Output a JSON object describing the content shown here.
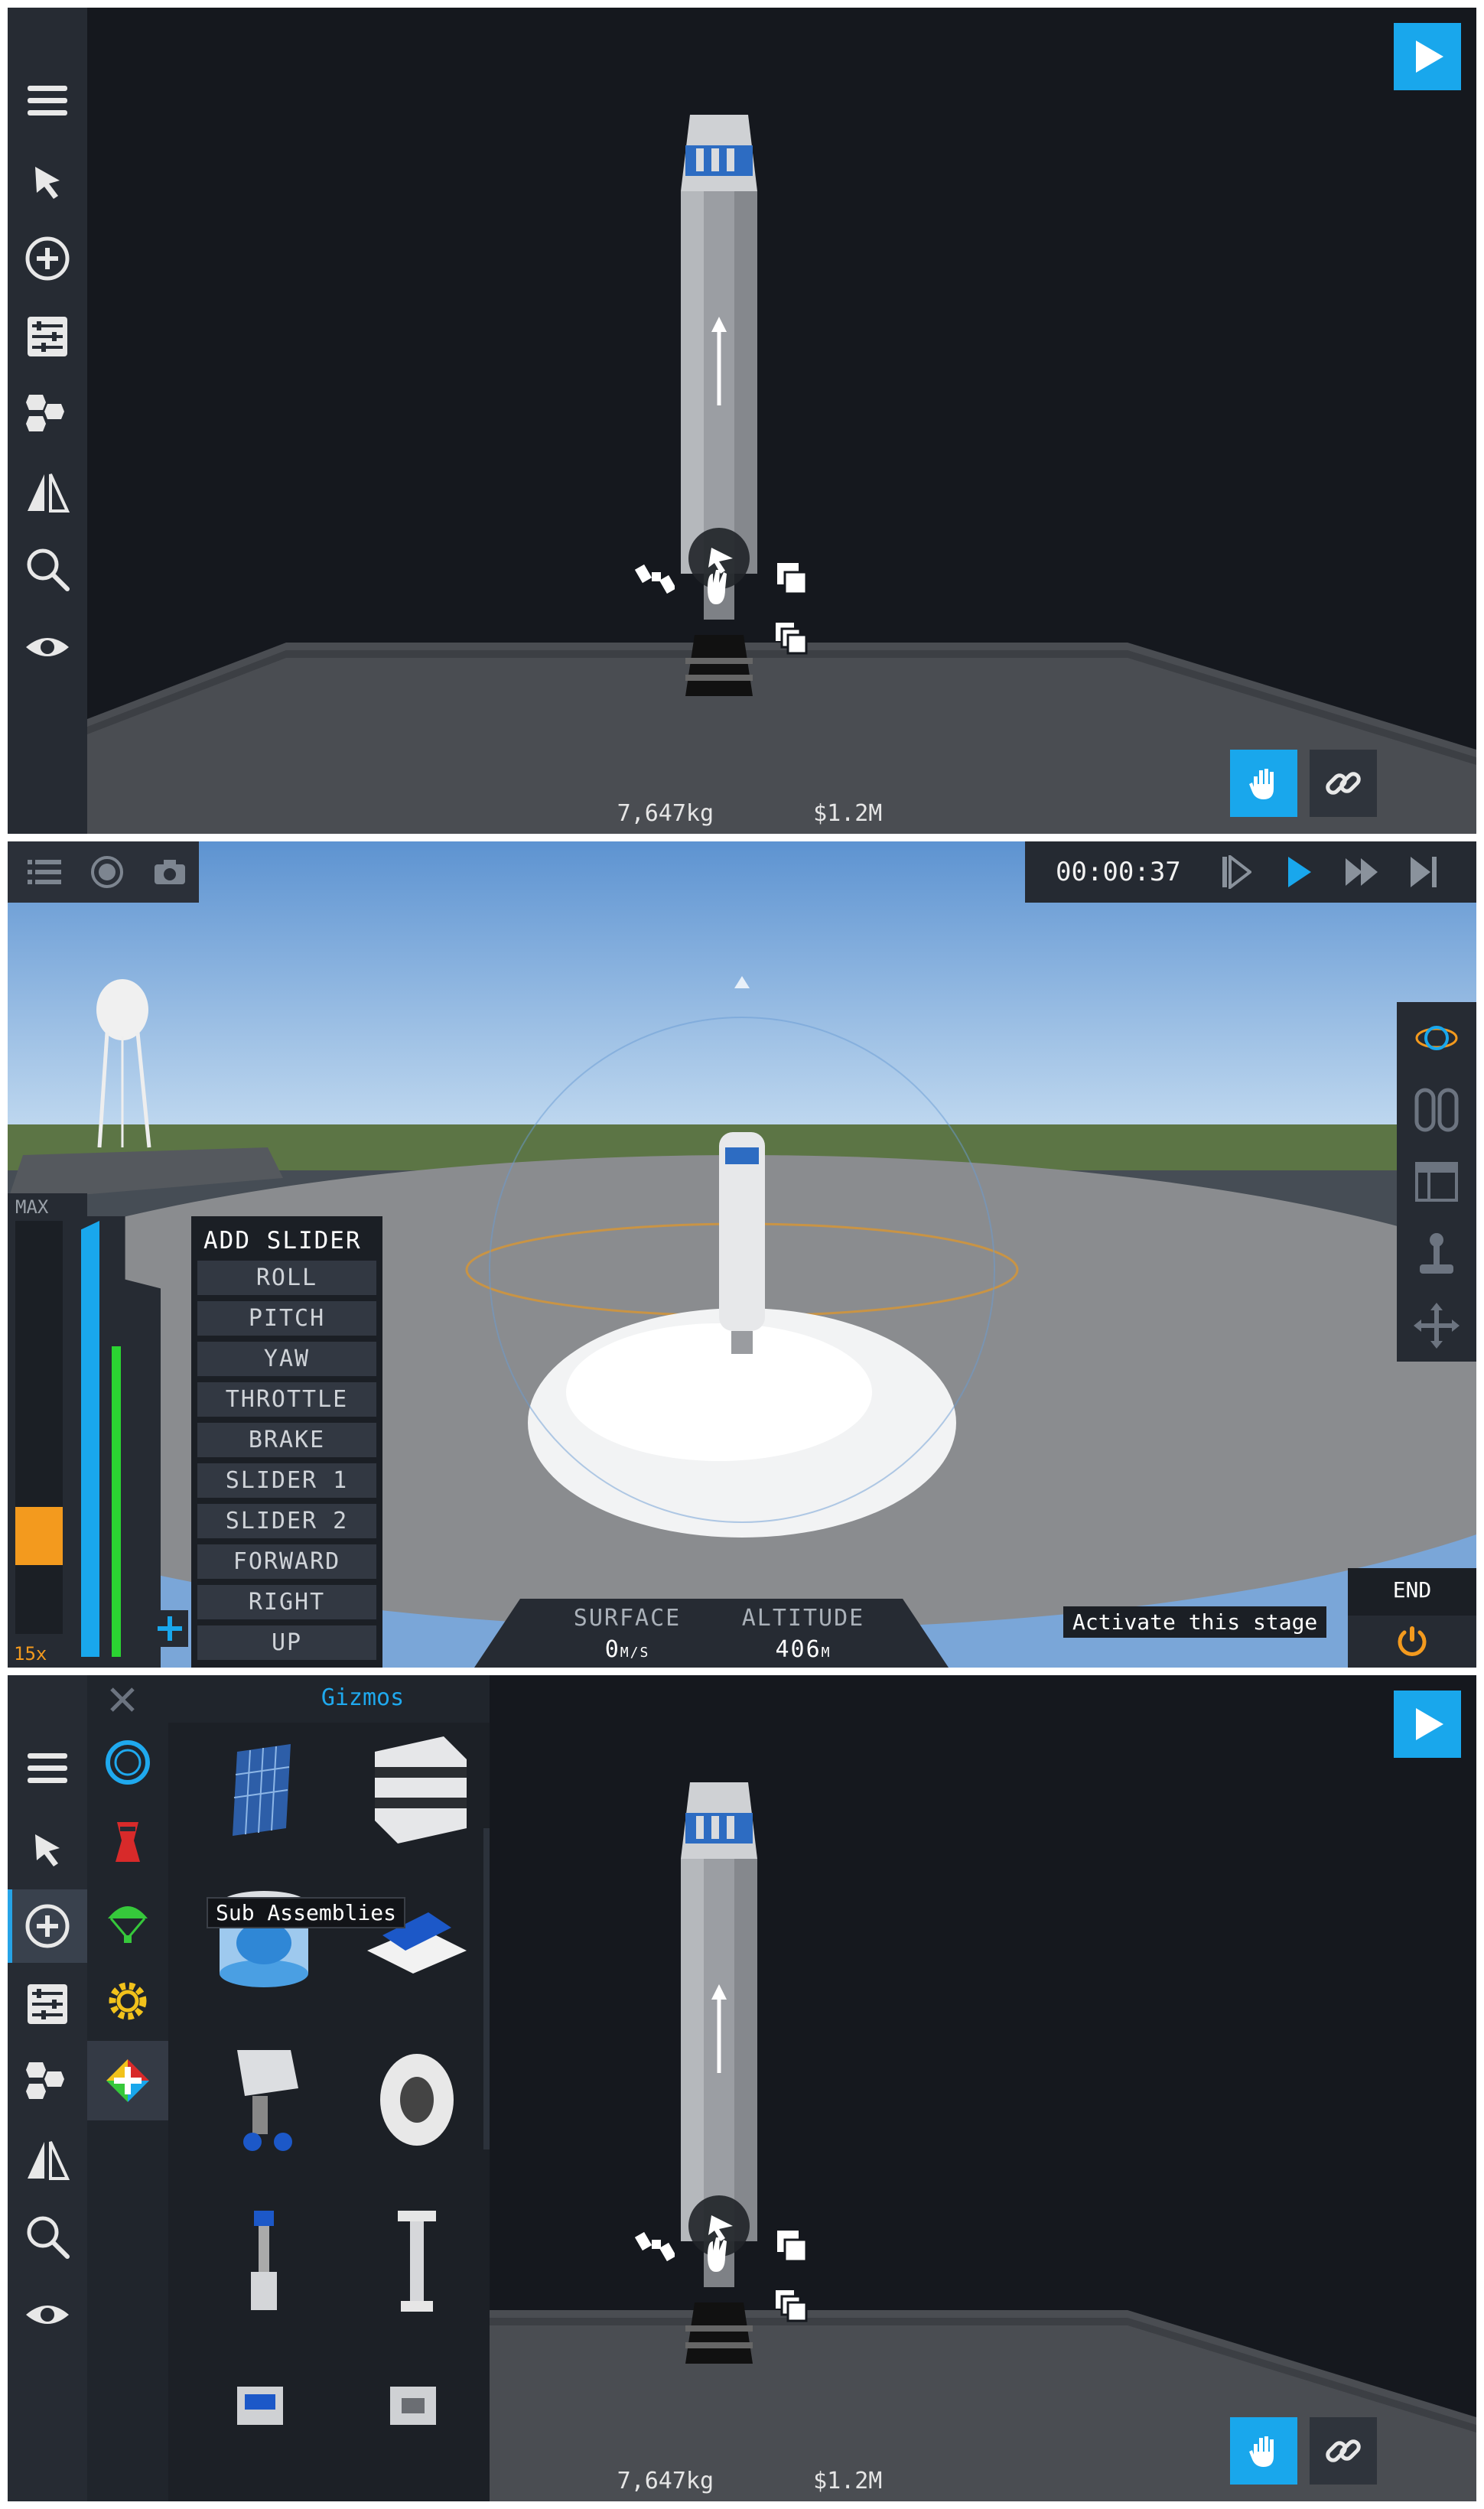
{
  "designer_top": {
    "mass": "7,647kg",
    "cost": "$1.2M",
    "toolbar_icons": [
      "menu-icon",
      "select-arrow-icon",
      "add-part-icon",
      "properties-icon",
      "staging-icon",
      "symmetry-icon",
      "search-icon",
      "view-icon"
    ]
  },
  "flight": {
    "clock": "00:00:37",
    "throttle_max_label": "MAX",
    "warp_label": "15x",
    "slider_menu": {
      "title": "ADD SLIDER",
      "items": [
        "ROLL",
        "PITCH",
        "YAW",
        "THROTTLE",
        "BRAKE",
        "SLIDER 1",
        "SLIDER 2",
        "FORWARD",
        "RIGHT",
        "UP"
      ]
    },
    "surface_label": "SURFACE",
    "surface_value": "0",
    "surface_unit": "M/S",
    "altitude_label": "ALTITUDE",
    "altitude_value": "406",
    "altitude_unit": "M",
    "activate_stage": "Activate this stage",
    "end_label": "END",
    "colors": {
      "accent": "#19a7ec",
      "end_power": "#f39a1e",
      "throttle_green": "#2bd432"
    }
  },
  "designer_bottom": {
    "parts_title": "Gizmos",
    "tooltip": "Sub Assemblies",
    "mass": "7,647kg",
    "cost": "$1.2M"
  }
}
